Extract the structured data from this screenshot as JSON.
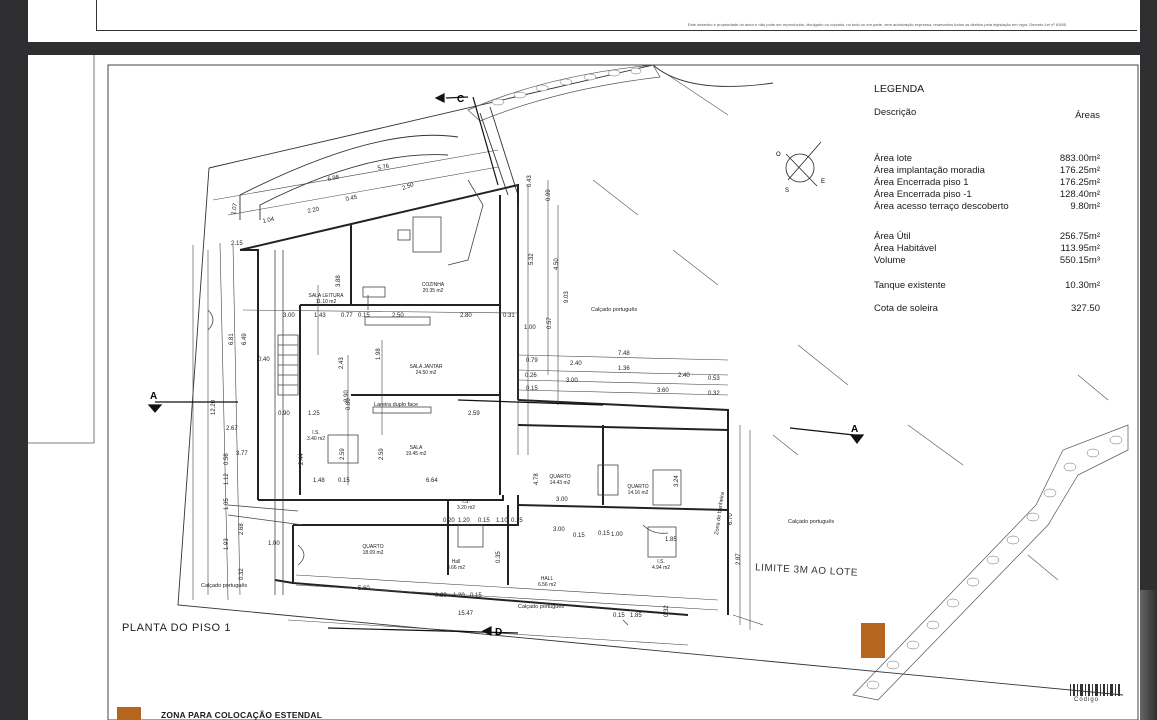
{
  "copyright": "Este desenho é propriedade do autor e não pode ser reproduzido, divulgado ou copiado, no todo ou em parte, sem autorização expressa, reservados todos os direitos pela legislação em vigor. Decreto-Lei nº 63/85",
  "legend": {
    "title": "LEGENDA",
    "col_desc": "Descrição",
    "col_areas": "Áreas",
    "rows": [
      {
        "label": "Área lote",
        "value": "883.00m²"
      },
      {
        "label": "Área implantação moradia",
        "value": "176.25m²"
      },
      {
        "label": "Área Encerrada piso 1",
        "value": "176.25m²"
      },
      {
        "label": "Área Encerrada piso -1",
        "value": "128.40m²"
      },
      {
        "label": "Área acesso terraço descoberto",
        "value": "9.80m²"
      },
      {
        "label": "Área Útil",
        "value": "256.75m²"
      },
      {
        "label": "Área Habitável",
        "value": "113.95m²"
      },
      {
        "label": "Volume",
        "value": "550.15m³"
      },
      {
        "label": "Tanque existente",
        "value": "10.30m²"
      },
      {
        "label": "Cota de soleira",
        "value": "327.50"
      }
    ]
  },
  "plan_title": "PLANTA DO PISO 1",
  "limite": "LIMITE 3M AO LOTE",
  "zone_title": "ZONA PARA COLOCAÇÃO ESTENDAL",
  "codigo": "Código",
  "section_marks": {
    "a_left": "A",
    "a_right": "A",
    "c": "C",
    "d": "D"
  },
  "compass": {
    "o": "O",
    "s": "S",
    "e": "E"
  },
  "rooms": [
    {
      "name": "SALA LEITURA",
      "area": "11.10 m2"
    },
    {
      "name": "COZINHA",
      "area": "20.35 m2"
    },
    {
      "name": "SALA JANTAR",
      "area": "24.50 m2"
    },
    {
      "name": "SALA",
      "area": "19.45 m2"
    },
    {
      "name": "I.S.",
      "area": "3.40 m2"
    },
    {
      "name": "QUARTO",
      "area": "18.09 m2"
    },
    {
      "name": "QUARTO",
      "area": "14.43 m2"
    },
    {
      "name": "QUARTO",
      "area": "14.16 m2"
    },
    {
      "name": "I.S.",
      "area": "3.20 m2"
    },
    {
      "name": "HALL",
      "area": "6.56 m2"
    },
    {
      "name": "Hall",
      "area": "3.66 m2"
    },
    {
      "name": "I.S.",
      "area": "4.94 m2"
    }
  ],
  "notes": {
    "calcado_1": "Calçado português",
    "calcado_2": "Calçado português",
    "calcado_3": "Calçado português",
    "calcado_4": "Calçado português",
    "lareira": "Lareira duplo face",
    "zona_banheira": "Zona de banheira"
  },
  "dims": [
    "5.76",
    "6.98",
    "2.50",
    "0.45",
    "2.20",
    "1.04",
    "1.07",
    "2.15",
    "3.88",
    "0.43",
    "0.99",
    "5.32",
    "4.50",
    "9.03",
    "6.81",
    "6.49",
    "0.40",
    "3.00",
    "1.43",
    "0.77",
    "0.15",
    "2.50",
    "2.80",
    "0.31",
    "1.00",
    "0.57",
    "1.98",
    "2.43",
    "7.48",
    "0.79",
    "2.40",
    "1.36",
    "2.40",
    "0.53",
    "0.26",
    "3.00",
    "0.15",
    "3.60",
    "0.32",
    "12.20",
    "2.67",
    "0.90",
    "1.25",
    "0.90",
    "2.59",
    "0.80",
    "3.77",
    "2.44",
    "2.59",
    "2.59",
    "1.48",
    "0.15",
    "6.64",
    "1.12",
    "0.56",
    "1.05",
    "2.68",
    "1.93",
    "0.32",
    "4.78",
    "3.00",
    "3.24",
    "0.20",
    "1.20",
    "0.15",
    "1.10",
    "0.15",
    "3.00",
    "0.15",
    "1.00",
    "1.85",
    "1.00",
    "5.60",
    "0.20",
    "1.20",
    "0.15",
    "15.47",
    "0.15",
    "1.85",
    "0.32",
    "0.35",
    "6.70",
    "2.87",
    "0.15"
  ]
}
